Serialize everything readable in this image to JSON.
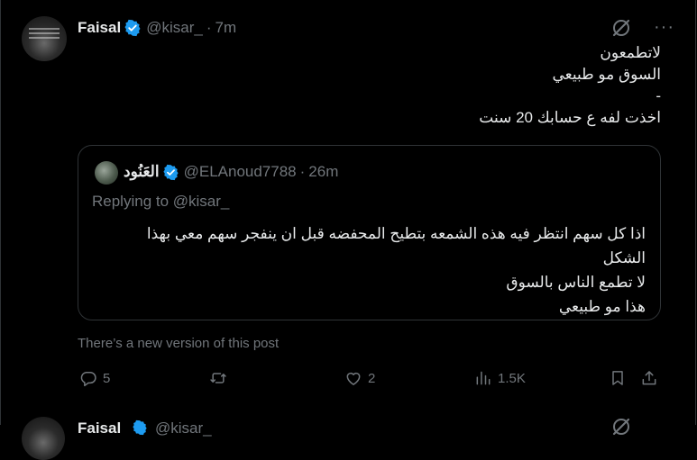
{
  "tweet": {
    "author_name": "Faisal",
    "handle": "@kisar_",
    "separator": "·",
    "time": "7m",
    "text_lines": [
      "لاتطمعون",
      "السوق مو طبيعي",
      "-",
      "اخذت لفه ع حسابك 20 سنت"
    ],
    "more_label": "···"
  },
  "quote": {
    "author_name": "العَنُود",
    "handle": "@ELAnoud7788",
    "separator": "·",
    "time": "26m",
    "replying_to": "Replying to @kisar_",
    "text_lines": [
      "اذا كل سهم انتظر فيه هذه الشمعه بتطيح المحفضه قبل ان ينفجر سهم معي بهذا",
      "الشكل",
      "لا تطمع الناس بالسوق",
      "هذا مو طبيعي"
    ]
  },
  "notice": {
    "new_version": "There’s a new version of this post"
  },
  "actions": {
    "reply_count": "5",
    "retweet_count": "",
    "like_count": "2",
    "views_count": "1.5K"
  },
  "next_tweet": {
    "author_name": "Faisal",
    "handle": "@kisar_"
  },
  "colors": {
    "accent": "#1d9bf0",
    "muted": "#71767b",
    "text": "#e7e9ea",
    "border": "#2f3336",
    "background": "#000000"
  },
  "icons": [
    "verified-badge-icon",
    "grok-icon",
    "more-icon",
    "reply-icon",
    "retweet-icon",
    "like-icon",
    "views-icon",
    "bookmark-icon",
    "share-icon"
  ]
}
